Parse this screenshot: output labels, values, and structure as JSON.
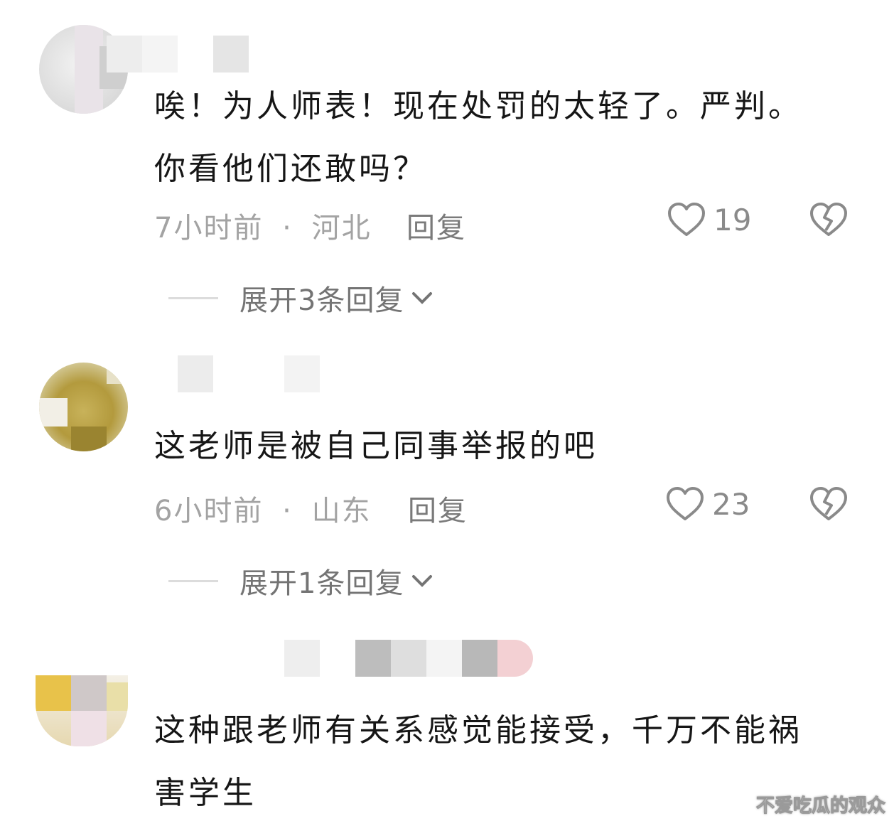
{
  "comments": [
    {
      "text_lines": [
        "唉！为人师表！现在处罚的太轻了。严判。",
        "你看他们还敢吗？"
      ],
      "time": "7小时前",
      "location": "河北",
      "reply_label": "回复",
      "likes": "19",
      "expand_label": "展开3条回复"
    },
    {
      "text_lines": [
        "这老师是被自己同事举报的吧"
      ],
      "time": "6小时前",
      "location": "山东",
      "reply_label": "回复",
      "likes": "23",
      "expand_label": "展开1条回复"
    },
    {
      "text_lines": [
        "这种跟老师有关系感觉能接受，千万不能祸",
        "害学生"
      ]
    }
  ],
  "meta_separator": "·",
  "icons": {
    "like": "heart-outline-icon",
    "dislike": "broken-heart-icon",
    "expand": "chevron-down-icon"
  },
  "watermark": "不爱吃瓜的观众",
  "colors": {
    "text": "#161616",
    "meta": "#a3a3a3",
    "icon": "#8a8a8a"
  }
}
